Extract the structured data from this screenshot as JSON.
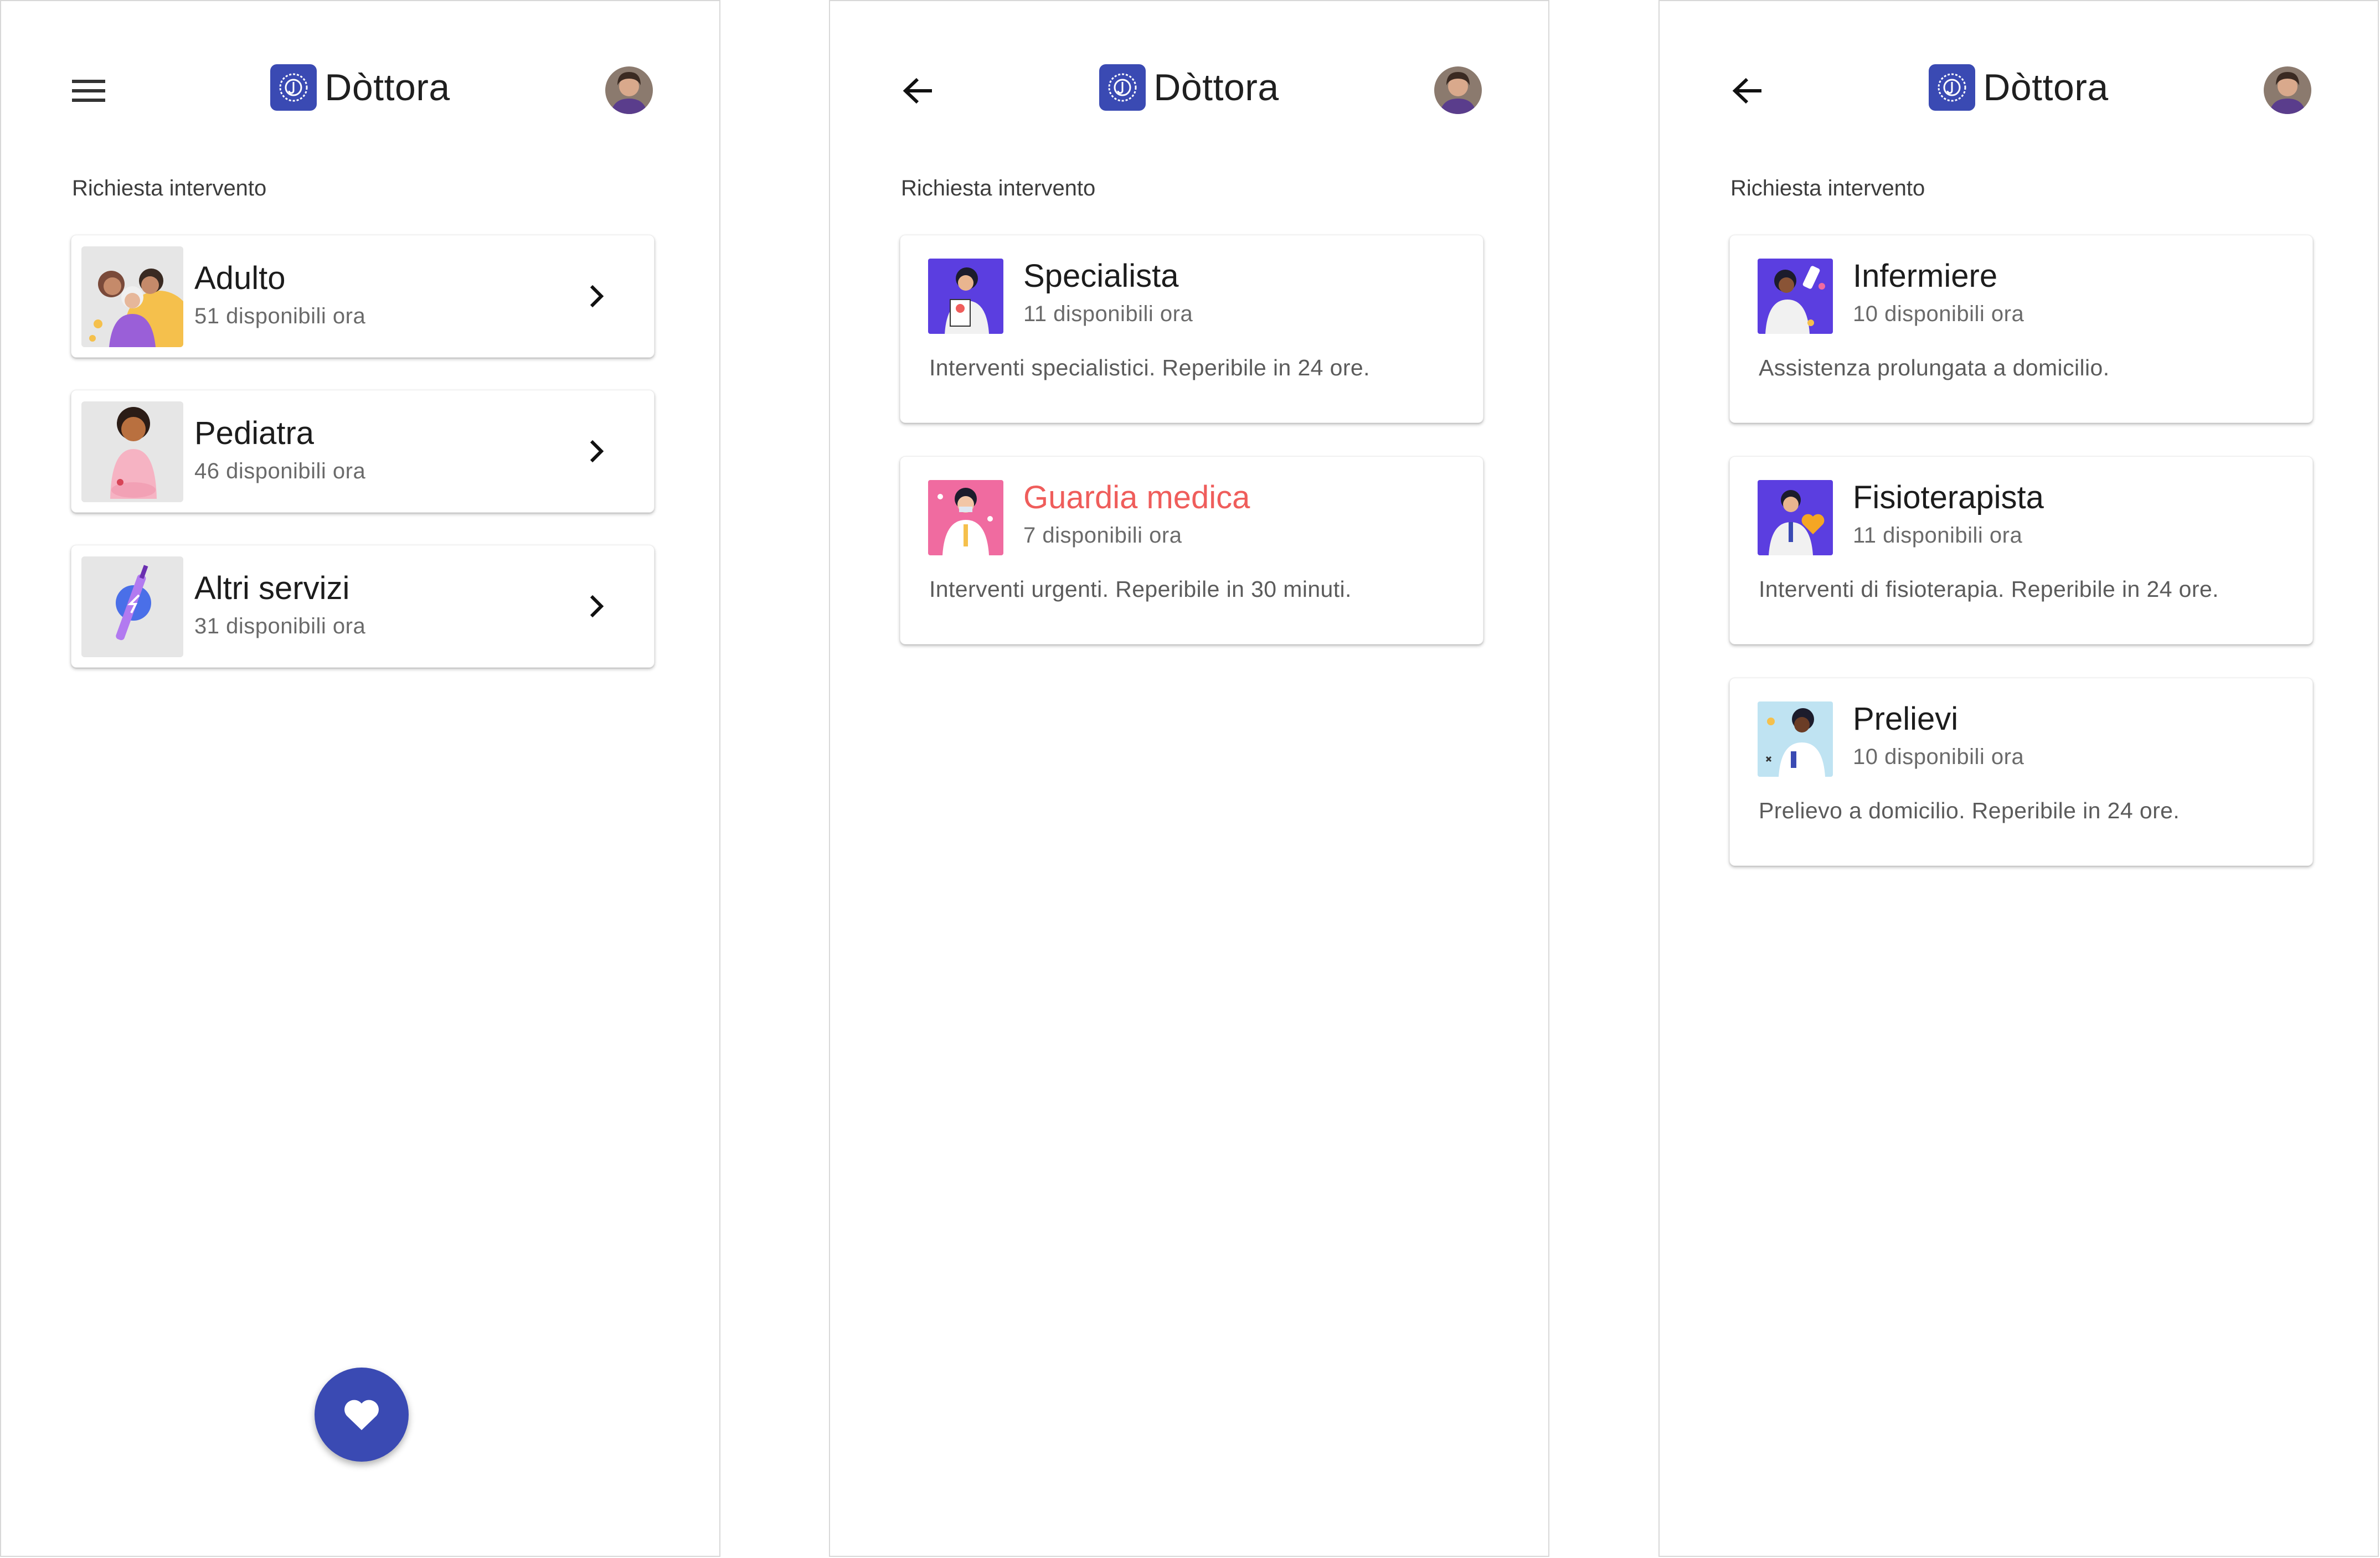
{
  "app": {
    "name": "Dòttora",
    "accent_color": "#3a4ab3",
    "alert_color": "#ef5d5b"
  },
  "screens": [
    {
      "nav_icon": "menu-icon",
      "section_title": "Richiesta intervento",
      "cards": [
        {
          "title": "Adulto",
          "subtitle": "51 disponibili ora",
          "illustration": "family-illustration"
        },
        {
          "title": "Pediatra",
          "subtitle": "46 disponibili ora",
          "illustration": "child-illustration"
        },
        {
          "title": "Altri servizi",
          "subtitle": "31 disponibili ora",
          "illustration": "syringe-illustration"
        }
      ],
      "fab_icon": "heart-icon"
    },
    {
      "nav_icon": "back-arrow-icon",
      "section_title": "Richiesta intervento",
      "cards": [
        {
          "title": "Specialista",
          "subtitle": "11 disponibili ora",
          "description": "Interventi specialistici. Reperibile in 24 ore.",
          "illustration": "specialist-illustration"
        },
        {
          "title": "Guardia medica",
          "subtitle": "7 disponibili ora",
          "description": "Interventi urgenti. Reperibile in 30 minuti.",
          "illustration": "emergency-doctor-illustration"
        }
      ]
    },
    {
      "nav_icon": "back-arrow-icon",
      "section_title": "Richiesta intervento",
      "cards": [
        {
          "title": "Infermiere",
          "subtitle": "10 disponibili ora",
          "description": "Assistenza prolungata a domicilio.",
          "illustration": "nurse-illustration"
        },
        {
          "title": "Fisioterapista",
          "subtitle": "11 disponibili ora",
          "description": "Interventi di fisioterapia. Reperibile in 24 ore.",
          "illustration": "physio-illustration"
        },
        {
          "title": "Prelievi",
          "subtitle": "10 disponibili ora",
          "description": "Prelievo a domicilio. Reperibile in 24 ore.",
          "illustration": "blood-test-illustration"
        }
      ]
    }
  ]
}
